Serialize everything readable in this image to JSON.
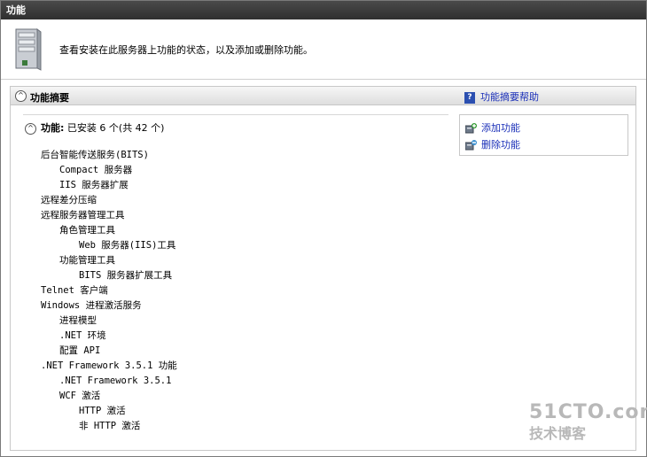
{
  "titlebar": {
    "title": "功能"
  },
  "intro": {
    "text": "查看安装在此服务器上功能的状态，以及添加或删除功能。",
    "icon": "server-icon"
  },
  "section": {
    "title": "功能摘要",
    "help_label": "功能摘要帮助",
    "features_label": "功能:",
    "features_count": "已安装 6 个(共 42 个)"
  },
  "features": [
    {
      "label": "后台智能传送服务(BITS)",
      "level": 0
    },
    {
      "label": "Compact 服务器",
      "level": 1
    },
    {
      "label": "IIS 服务器扩展",
      "level": 1
    },
    {
      "label": "远程差分压缩",
      "level": 0
    },
    {
      "label": "远程服务器管理工具",
      "level": 0
    },
    {
      "label": "角色管理工具",
      "level": 1
    },
    {
      "label": "Web 服务器(IIS)工具",
      "level": 2
    },
    {
      "label": "功能管理工具",
      "level": 1
    },
    {
      "label": "BITS 服务器扩展工具",
      "level": 2
    },
    {
      "label": "Telnet 客户端",
      "level": 0
    },
    {
      "label": "Windows 进程激活服务",
      "level": 0
    },
    {
      "label": "进程模型",
      "level": 1
    },
    {
      "label": ".NET 环境",
      "level": 1
    },
    {
      "label": "配置 API",
      "level": 1
    },
    {
      "label": ".NET Framework 3.5.1 功能",
      "level": 0
    },
    {
      "label": ".NET Framework 3.5.1",
      "level": 1
    },
    {
      "label": "WCF 激活",
      "level": 1
    },
    {
      "label": "HTTP 激活",
      "level": 2
    },
    {
      "label": "非 HTTP 激活",
      "level": 2
    }
  ],
  "tasks": [
    {
      "label": "添加功能",
      "icon": "add-feature-icon"
    },
    {
      "label": "删除功能",
      "icon": "remove-feature-icon"
    }
  ],
  "watermark": {
    "line1": "51CTO.com",
    "line2": "技术博客"
  },
  "colors": {
    "titlebar": "#3a3a3a",
    "link": "#1a2fb8"
  }
}
